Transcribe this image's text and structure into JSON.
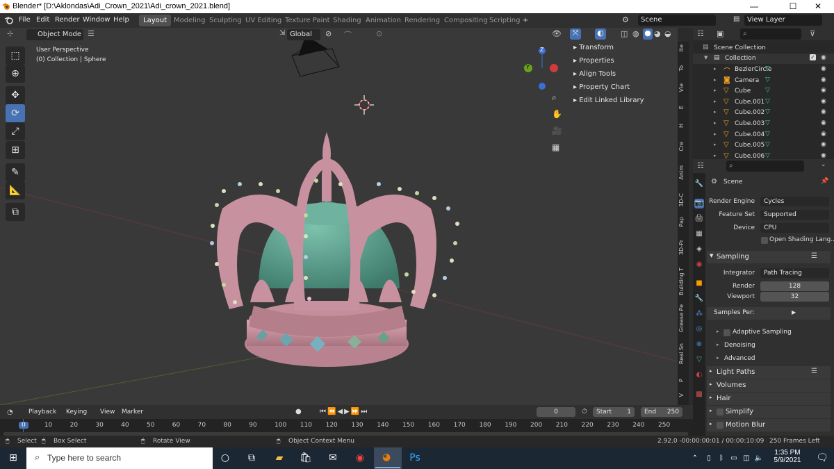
{
  "titlebar": {
    "title": "Blender* [D:\\Aklondas\\Adi_Crown_2021\\Adi_crown_2021.blend]",
    "minimize": "—",
    "maximize": "☐",
    "close": "✕"
  },
  "menubar": {
    "menus": [
      "File",
      "Edit",
      "Render",
      "Window",
      "Help"
    ],
    "workspaces": [
      "Layout",
      "Modeling",
      "Sculpting",
      "UV Editing",
      "Texture Paint",
      "Shading",
      "Animation",
      "Rendering",
      "Compositing",
      "Scripting"
    ],
    "add_workspace": "+",
    "scene": "Scene",
    "view_layer": "View Layer"
  },
  "viewport": {
    "mode": "Object Mode",
    "transform_orientation": "Global",
    "overlay_line1": "User Perspective",
    "overlay_line2": "(0) Collection | Sphere",
    "gizmo_axes": {
      "z": "Z",
      "y": "Y"
    },
    "npanel": [
      "Transform",
      "Properties",
      "Align Tools",
      "Property Chart",
      "Edit Linked Library"
    ],
    "side_tabs": [
      "Ite",
      "To",
      "Vie",
      "E",
      "H",
      "Cre",
      "Anim",
      "3D-C",
      "Pap",
      "3D-Pr",
      "Building T",
      "Grease Pe",
      "Real Sn",
      "P",
      "V"
    ]
  },
  "outliner": {
    "root": "Scene Collection",
    "collection": "Collection",
    "items": [
      {
        "name": "BezierCircle",
        "icon": "curve-icon"
      },
      {
        "name": "Camera",
        "icon": "camera-icon"
      },
      {
        "name": "Cube",
        "icon": "mesh-icon"
      },
      {
        "name": "Cube.001",
        "icon": "mesh-icon"
      },
      {
        "name": "Cube.002",
        "icon": "mesh-icon"
      },
      {
        "name": "Cube.003",
        "icon": "mesh-icon"
      },
      {
        "name": "Cube.004",
        "icon": "mesh-icon"
      },
      {
        "name": "Cube.005",
        "icon": "mesh-icon"
      },
      {
        "name": "Cube.006",
        "icon": "mesh-icon"
      }
    ]
  },
  "properties": {
    "context": "Scene",
    "render_engine_label": "Render Engine",
    "render_engine": "Cycles",
    "feature_set_label": "Feature Set",
    "feature_set": "Supported",
    "device_label": "Device",
    "device": "CPU",
    "osl": "Open Shading Lang...",
    "sampling": "Sampling",
    "integrator_label": "Integrator",
    "integrator": "Path Tracing",
    "render_label": "Render",
    "render_samples": "128",
    "viewport_label": "Viewport",
    "viewport_samples": "32",
    "samples_per": "Samples Per:",
    "adaptive": "Adaptive Sampling",
    "denoising": "Denoising",
    "advanced": "Advanced",
    "light_paths": "Light Paths",
    "volumes": "Volumes",
    "hair": "Hair",
    "simplify": "Simplify",
    "motion_blur": "Motion Blur"
  },
  "timeline": {
    "menus": [
      "Playback",
      "Keying",
      "View",
      "Marker"
    ],
    "current_frame": "0",
    "start_label": "Start",
    "start": "1",
    "end_label": "End",
    "end": "250",
    "ruler": [
      "0",
      "10",
      "20",
      "30",
      "40",
      "50",
      "60",
      "70",
      "80",
      "90",
      "100",
      "110",
      "120",
      "130",
      "140",
      "150",
      "160",
      "170",
      "180",
      "190",
      "200",
      "210",
      "220",
      "230",
      "240",
      "250"
    ]
  },
  "statusbar": {
    "select": "Select",
    "box_select": "Box Select",
    "rotate_view": "Rotate View",
    "context_menu": "Object Context Menu",
    "info": "2.92.0 -00:00:00:01 / 00:00:10:09",
    "frames_left": "250 Frames Left"
  },
  "taskbar": {
    "search_placeholder": "Type here to search",
    "time": "1:35 PM",
    "date": "5/9/2021"
  },
  "colors": {
    "crown": "#c88f9a",
    "dome": "#5e9e8c",
    "accent": "#4772b3"
  }
}
